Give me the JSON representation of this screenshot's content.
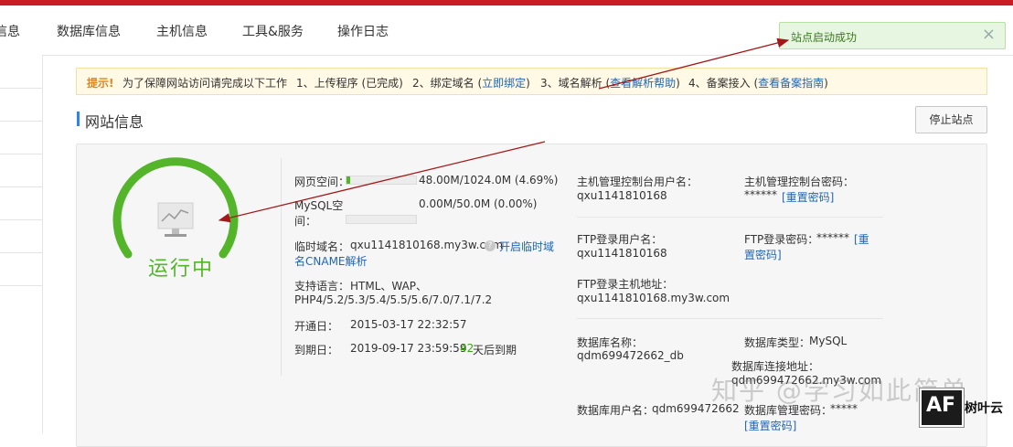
{
  "nav": {
    "items": [
      "信息",
      "数据库信息",
      "主机信息",
      "工具&服务",
      "操作日志"
    ]
  },
  "toast": {
    "message": "站点启动成功",
    "close_glyph": "×"
  },
  "notice": {
    "label": "提示!",
    "intro": "为了保障网站访问请完成以下工作",
    "step1": "1、上传程序 (已完成)",
    "step2_prefix": "2、绑定域名 (",
    "step2_link": "立即绑定",
    "step2_suffix": ")",
    "step3_prefix": "3、域名解析 (",
    "step3_link": "查看解析帮助",
    "step3_suffix": ")",
    "step4_prefix": "4、备案接入 (",
    "step4_link": "查看备案指南",
    "step4_suffix": ")"
  },
  "page": {
    "title": "网站信息",
    "stop_button": "停止站点"
  },
  "status": {
    "text": "运行中",
    "gauge_fraction": 0.78
  },
  "info": {
    "web_space_label": "网页空间：",
    "web_space_value": "48.00M/1024.0M (4.69%)",
    "web_space_fraction": 0.0469,
    "mysql_label_1": "MySQL空",
    "mysql_label_2": "间：",
    "mysql_value": "0.00M/50.0M (0.00%)",
    "mysql_fraction": 0.0,
    "temp_domain_label": "临时域名：",
    "temp_domain_value": "qxu1141810168.my3w.com",
    "temp_domain_link_1": "开启临时域",
    "temp_domain_link_2": "名CNAME解析",
    "lang_label": "支持语言：",
    "lang_value_1": "HTML、WAP、",
    "lang_value_2": "PHP4/5.2/5.3/5.4/5.5/5.6/7.0/7.1/7.2",
    "open_label": "开通日：",
    "open_value": "2015-03-17 22:32:57",
    "expire_label": "到期日：",
    "expire_value": "2019-09-17 23:59:59",
    "expire_days": "42",
    "expire_suffix": "天后到期"
  },
  "host": {
    "ctrl_user_label": "主机管理控制台用户名：",
    "ctrl_user_value": "qxu1141810168",
    "ctrl_pwd_label": "主机管理控制台密码：",
    "ctrl_pwd_value": "******",
    "reset_pwd": "[重置密码]",
    "ftp_user_label": "FTP登录用户名：",
    "ftp_user_value": "qxu1141810168",
    "ftp_pwd_label": "FTP登录密码：",
    "ftp_pwd_value": "******",
    "ftp_reset_1": "[重",
    "ftp_reset_2": "置密码]",
    "ftp_host_label": "FTP登录主机地址：",
    "ftp_host_value": "qxu1141810168.my3w.com"
  },
  "db": {
    "name_label": "数据库名称：",
    "name_value": "qdm699472662_db",
    "type_label": "数据库类型：",
    "type_value": "MySQL",
    "addr_label": "数据库连接地址：",
    "addr_value": "qdm699472662.my3w.com",
    "user_label": "数据库用户名：",
    "user_value": "qdm699472662",
    "pwd_label": "数据库管理密码：",
    "pwd_value": "*****",
    "reset_pwd": "[重置密码]"
  },
  "watermark": {
    "text": "知乎 @学习如此简单",
    "brand_logo": "AF",
    "brand_name": "树叶云"
  },
  "colors": {
    "accent_red": "#c81d25",
    "status_green": "#54b52a",
    "link_blue": "#2166b5",
    "annotation_arrow": "#a31818"
  }
}
